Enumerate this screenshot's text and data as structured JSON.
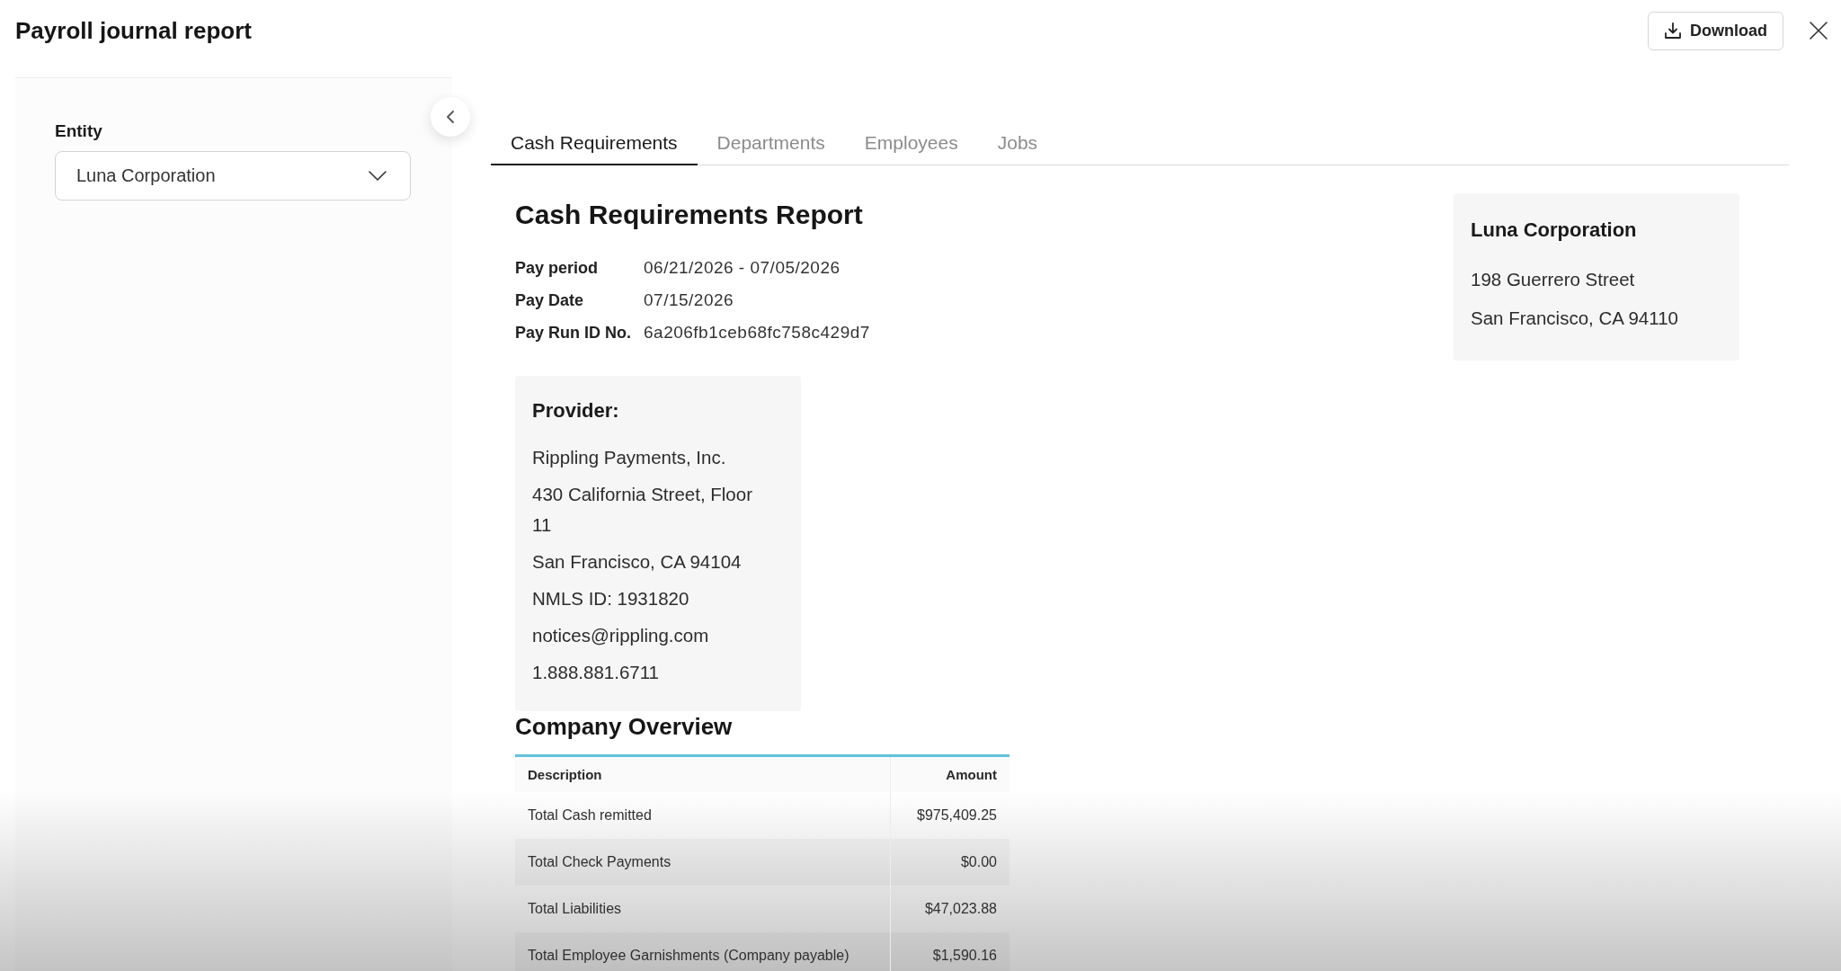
{
  "header": {
    "title": "Payroll journal report",
    "download_label": "Download"
  },
  "sidebar": {
    "entity_label": "Entity",
    "entity_value": "Luna Corporation"
  },
  "tabs": [
    {
      "label": "Cash Requirements",
      "selected": true
    },
    {
      "label": "Departments",
      "selected": false
    },
    {
      "label": "Employees",
      "selected": false
    },
    {
      "label": "Jobs",
      "selected": false
    }
  ],
  "report": {
    "title": "Cash Requirements Report",
    "details": [
      {
        "label": "Pay period",
        "value": "06/21/2026 - 07/05/2026"
      },
      {
        "label": "Pay Date",
        "value": "07/15/2026"
      },
      {
        "label": "Pay Run ID No.",
        "value": "6a206fb1ceb68fc758c429d7"
      }
    ],
    "provider": {
      "heading": "Provider:",
      "lines": [
        "Rippling Payments, Inc.",
        "430 California Street, Floor 11",
        "San Francisco, CA 94104",
        "NMLS ID: 1931820",
        "notices@rippling.com",
        "1.888.881.6711"
      ]
    },
    "company": {
      "name": "Luna Corporation",
      "address": [
        "198 Guerrero Street",
        "San Francisco, CA 94110"
      ]
    },
    "overview": {
      "title": "Company Overview",
      "columns": [
        "Description",
        "Amount"
      ],
      "rows": [
        {
          "description": "Total Cash remitted",
          "amount": "$975,409.25"
        },
        {
          "description": "Total Check Payments",
          "amount": "$0.00"
        },
        {
          "description": "Total Liabilities",
          "amount": "$47,023.88"
        },
        {
          "description": "Total Employee Garnishments (Company payable)",
          "amount": "$1,590.16"
        }
      ]
    }
  }
}
